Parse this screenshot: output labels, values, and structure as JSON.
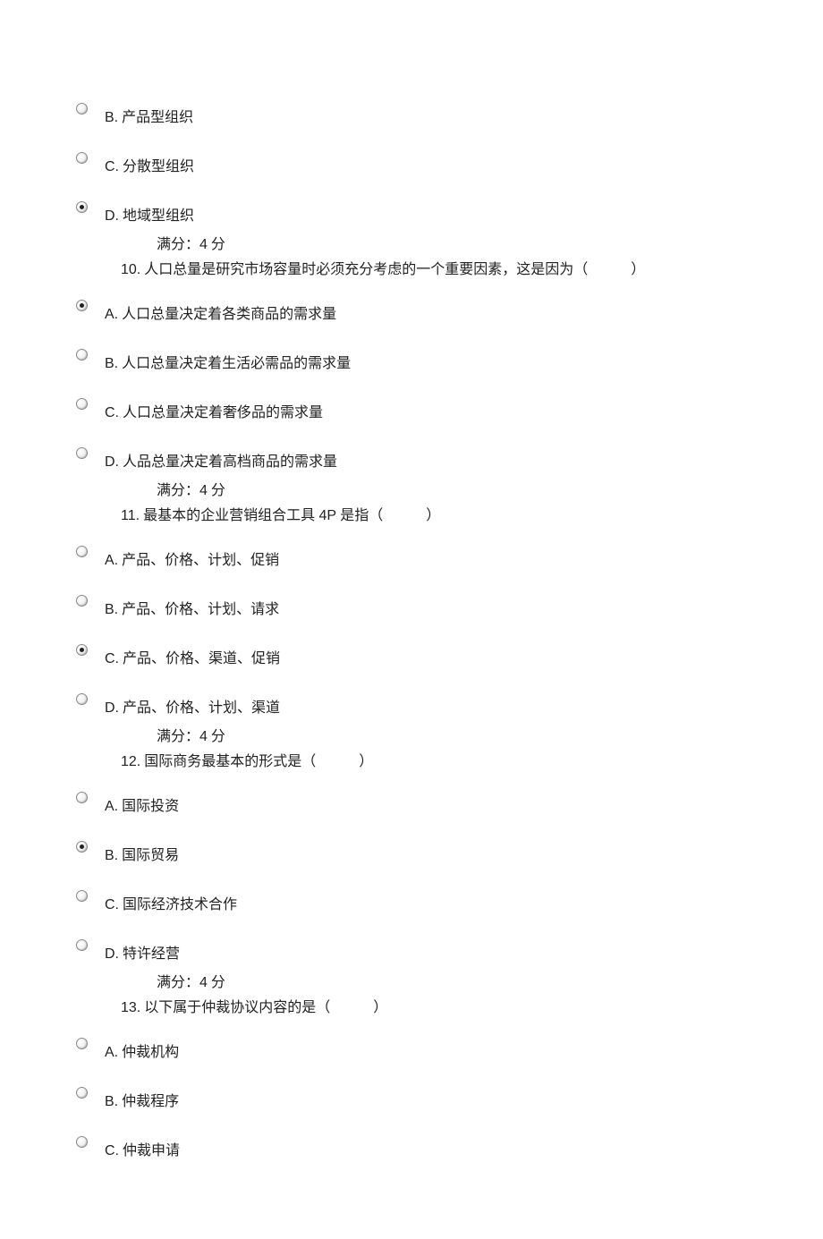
{
  "q9": {
    "options": [
      {
        "letter": "B.",
        "text": "产品型组织",
        "selected": false
      },
      {
        "letter": "C.",
        "text": "分散型组织",
        "selected": false
      },
      {
        "letter": "D.",
        "text": "地域型组织",
        "selected": true
      }
    ],
    "score_label": "满分：",
    "score_value": "4",
    "score_unit": "分"
  },
  "q10": {
    "num": "10.",
    "text": "人口总量是研究市场容量时必须充分考虑的一个重要因素，这是因为（　　　）",
    "options": [
      {
        "letter": "A.",
        "text": "人口总量决定着各类商品的需求量",
        "selected": true
      },
      {
        "letter": "B.",
        "text": "人口总量决定着生活必需品的需求量",
        "selected": false
      },
      {
        "letter": "C.",
        "text": "人口总量决定着奢侈品的需求量",
        "selected": false
      },
      {
        "letter": "D.",
        "text": "人品总量决定着高档商品的需求量",
        "selected": false
      }
    ],
    "score_label": "满分：",
    "score_value": "4",
    "score_unit": "分"
  },
  "q11": {
    "num": "11.",
    "text": "最基本的企业营销组合工具 4P 是指（　　　）",
    "options": [
      {
        "letter": "A.",
        "text": "产品、价格、计划、促销",
        "selected": false
      },
      {
        "letter": "B.",
        "text": "产品、价格、计划、请求",
        "selected": false
      },
      {
        "letter": "C.",
        "text": "产品、价格、渠道、促销",
        "selected": true
      },
      {
        "letter": "D.",
        "text": "产品、价格、计划、渠道",
        "selected": false
      }
    ],
    "score_label": "满分：",
    "score_value": "4",
    "score_unit": "分"
  },
  "q12": {
    "num": "12.",
    "text": "国际商务最基本的形式是（　　　）",
    "options": [
      {
        "letter": "A.",
        "text": "国际投资",
        "selected": false
      },
      {
        "letter": "B.",
        "text": "国际贸易",
        "selected": true
      },
      {
        "letter": "C.",
        "text": "国际经济技术合作",
        "selected": false
      },
      {
        "letter": "D.",
        "text": "特许经营",
        "selected": false
      }
    ],
    "score_label": "满分：",
    "score_value": "4",
    "score_unit": "分"
  },
  "q13": {
    "num": "13.",
    "text": "以下属于仲裁协议内容的是（　　　）",
    "options": [
      {
        "letter": "A.",
        "text": "仲裁机构",
        "selected": false
      },
      {
        "letter": "B.",
        "text": "仲裁程序",
        "selected": false
      },
      {
        "letter": "C.",
        "text": "仲裁申请",
        "selected": false
      }
    ]
  }
}
